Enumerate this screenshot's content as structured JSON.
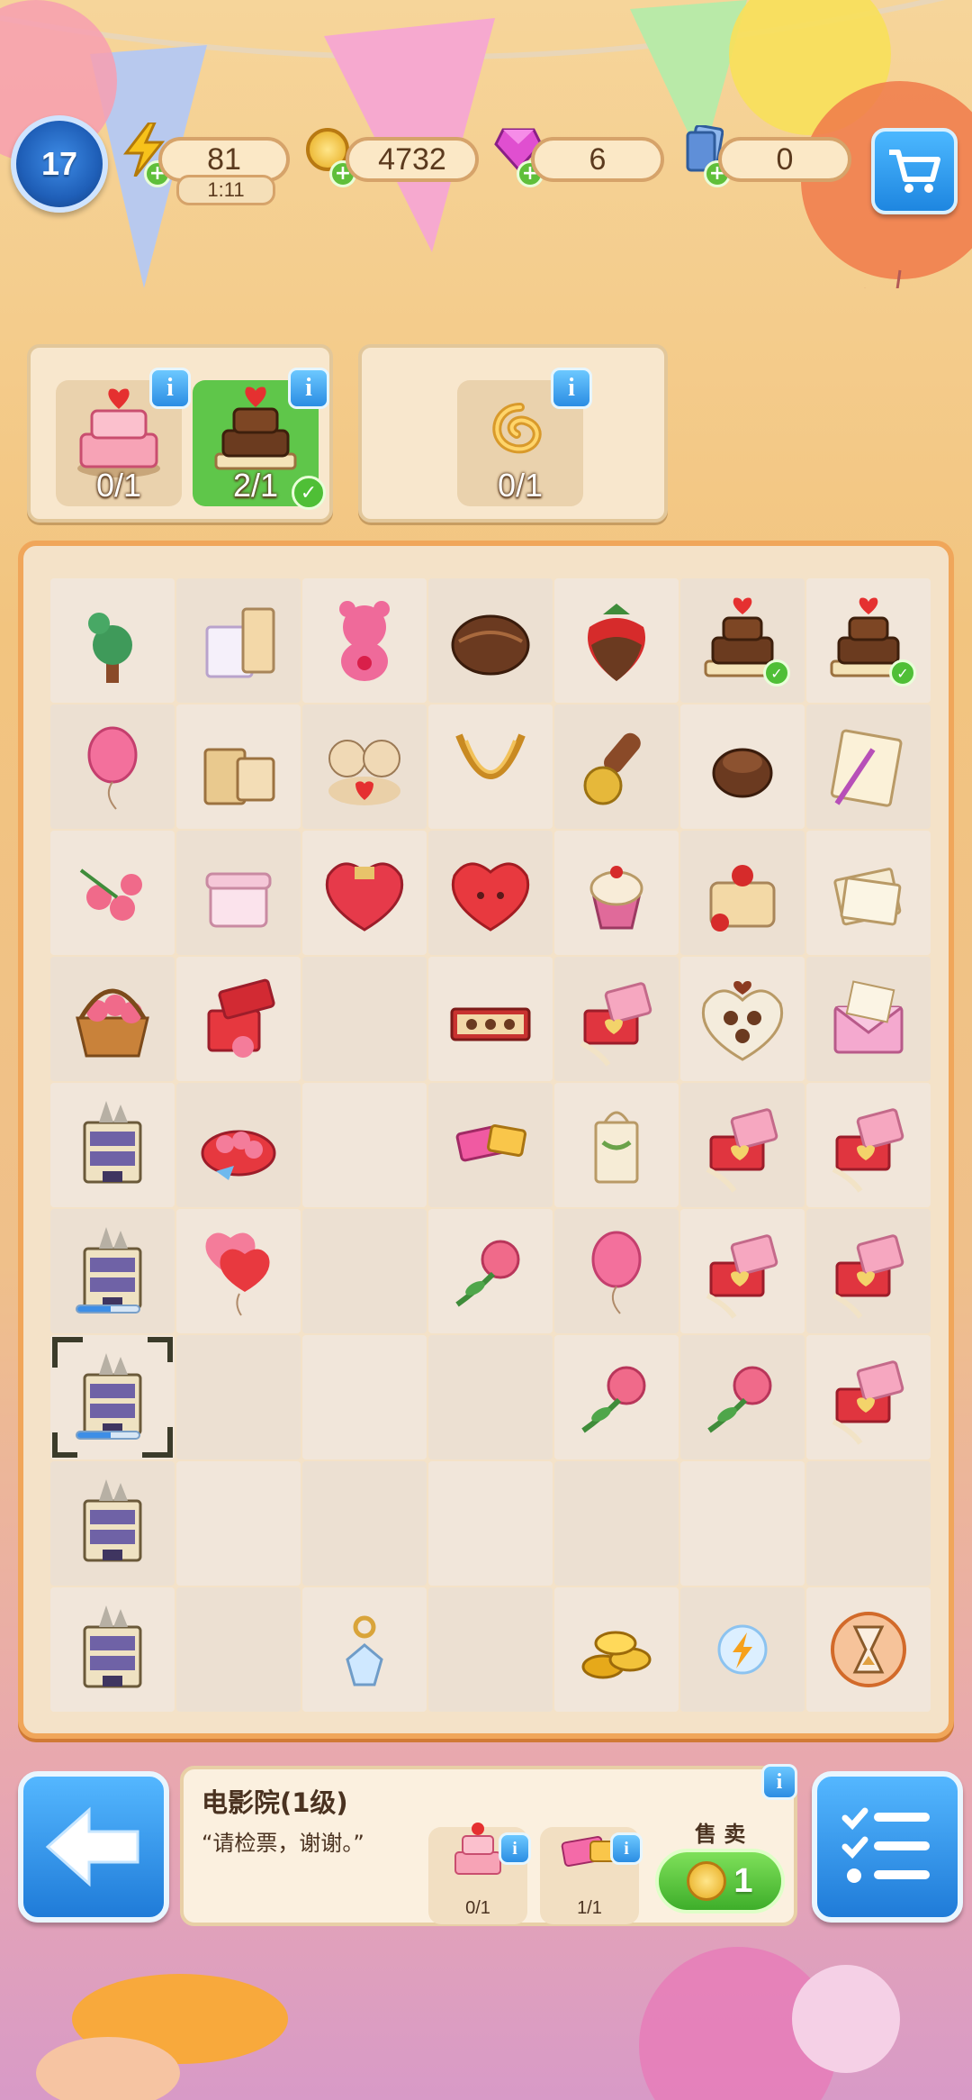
{
  "top_bar": {
    "level": "17",
    "energy": "81",
    "energy_timer": "1:11",
    "coins": "4732",
    "gems": "6",
    "cards": "0",
    "colors": {
      "level_badge": "#1f5fb8",
      "plus": "#5fbf3a",
      "cart": "#1e86e0"
    }
  },
  "orders": [
    {
      "items": [
        {
          "icon": "strawberry-cake-icon",
          "count": "0/1",
          "done": false
        },
        {
          "icon": "chocolate-cake-icon",
          "count": "2/1",
          "done": true
        }
      ]
    },
    {
      "items": [
        {
          "icon": "gold-ring-icon",
          "count": "0/1",
          "done": false
        }
      ]
    }
  ],
  "board": {
    "rows": [
      [
        "cupid-topiary",
        "gift-bags",
        "pink-teddy-bear",
        "chocolate-truffle",
        "chocolate-strawberry",
        "chocolate-cake",
        "chocolate-cake"
      ],
      [
        "pink-balloon",
        "shopping-bags",
        "teddy-couple",
        "gold-necklace",
        "wax-seal-stamp",
        "chocolate-bonbon",
        "love-letter-quill"
      ],
      [
        "red-roses",
        "pink-gift-box",
        "heart-gift-box",
        "red-heart",
        "cupcake",
        "strawberry-charlotte",
        "paper-sheets"
      ],
      [
        "rose-basket",
        "rose-box",
        "",
        "chocolate-box",
        "ring-box",
        "heart-chocolate-box",
        "pink-envelope"
      ],
      [
        "cinema-building",
        "rose-tin",
        "",
        "cinema-tickets",
        "gift-bag",
        "ring-box",
        "ring-box"
      ],
      [
        "cinema-building",
        "heart-balloons",
        "",
        "rose",
        "pink-balloon",
        "ring-box",
        "ring-box"
      ],
      [
        "cinema-building",
        "",
        "",
        "",
        "rose",
        "rose",
        "ring-box"
      ],
      [
        "cinema-building",
        "",
        "",
        "",
        "",
        "",
        ""
      ],
      [
        "cinema-building",
        "",
        "crystal-pendant",
        "",
        "gold-coins",
        "energy-orb",
        "hourglass"
      ]
    ]
  },
  "info_panel": {
    "title": "电影院(1级)",
    "description": "“请检票，谢谢。”",
    "products": [
      {
        "icon": "strawberry-cake-icon",
        "count": "0/1"
      },
      {
        "icon": "cinema-ticket-icon",
        "count": "1/1"
      }
    ],
    "sell_label": "售 卖",
    "sell_price": "1"
  }
}
